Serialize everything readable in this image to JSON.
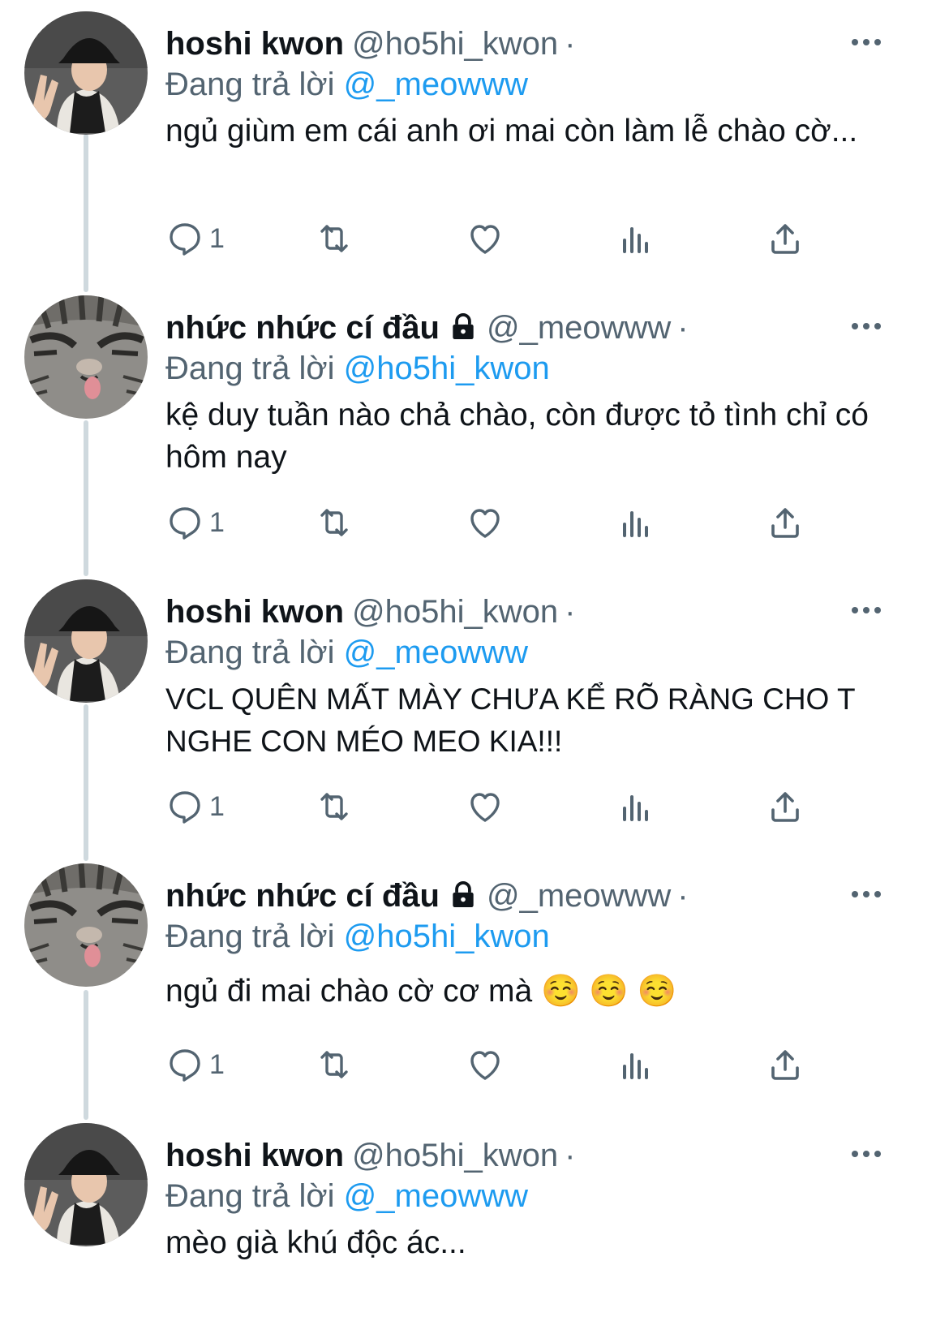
{
  "thread": [
    {
      "author": "hoshi kwon",
      "handle": "@ho5hi_kwon",
      "dot": "·",
      "replying_prefix": "Đang trả lời",
      "replying_to": "@_meowww",
      "text": "ngủ giùm em cái anh ơi mai còn làm lễ chào cờ...",
      "reply_count": "1",
      "protected": false,
      "avatar": "person-avatar"
    },
    {
      "author": "nhức nhức cí đầu",
      "handle": "@_meowww",
      "dot": "·",
      "replying_prefix": "Đang trả lời",
      "replying_to": "@ho5hi_kwon",
      "text": "kệ duy tuần nào chả chào, còn được tỏ tình chỉ có hôm nay",
      "reply_count": "1",
      "protected": true,
      "avatar": "cat-avatar"
    },
    {
      "author": "hoshi kwon",
      "handle": "@ho5hi_kwon",
      "dot": "·",
      "replying_prefix": "Đang trả lời",
      "replying_to": "@_meowww",
      "text": "VCL QUÊN MẤT MÀY CHƯA KỂ RÕ RÀNG CHO T NGHE CON MÉO MEO KIA!!!",
      "reply_count": "1",
      "protected": false,
      "avatar": "person-avatar"
    },
    {
      "author": "nhức nhức cí đầu",
      "handle": "@_meowww",
      "dot": "·",
      "replying_prefix": "Đang trả lời",
      "replying_to": "@ho5hi_kwon",
      "text": "ngủ đi mai chào cờ cơ mà ☺️ ☺️ ☺️",
      "reply_count": "1",
      "protected": true,
      "avatar": "cat-avatar"
    },
    {
      "author": "hoshi kwon",
      "handle": "@ho5hi_kwon",
      "dot": "·",
      "replying_prefix": "Đang trả lời",
      "replying_to": "@_meowww",
      "text": "mèo già khú độc ác...",
      "reply_count": "",
      "protected": false,
      "avatar": "person-avatar"
    }
  ],
  "icons": [
    "reply-icon",
    "retweet-icon",
    "like-icon",
    "views-icon",
    "share-icon",
    "more-icon",
    "lock-icon"
  ],
  "colors": {
    "link": "#1d9bf0",
    "secondary": "#536471",
    "thread_line": "#cfd9de"
  }
}
